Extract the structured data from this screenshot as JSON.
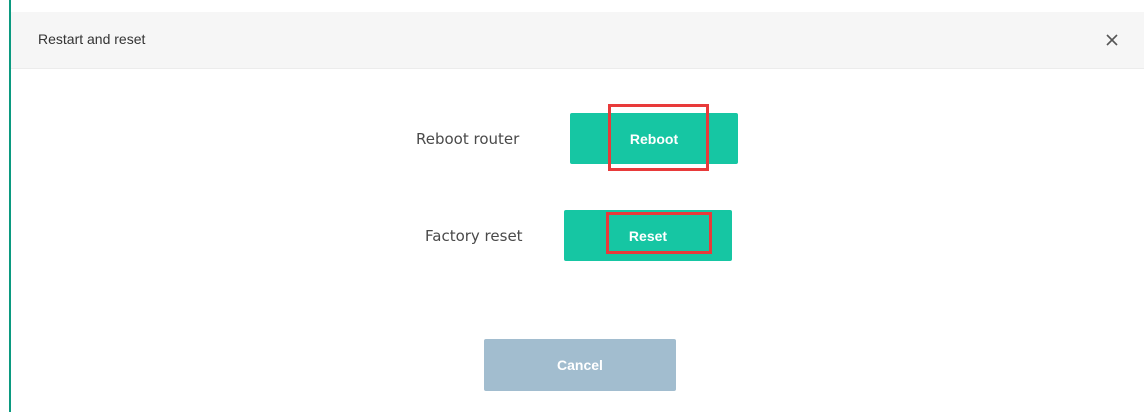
{
  "dialog": {
    "title": "Restart and reset",
    "close_icon": "close-icon"
  },
  "rows": {
    "reboot": {
      "label": "Reboot router",
      "button_label": "Reboot"
    },
    "reset": {
      "label": "Factory reset",
      "button_label": "Reset"
    }
  },
  "footer": {
    "cancel_label": "Cancel"
  },
  "colors": {
    "accent": "#16c6a3",
    "cancel": "#a2bdcf",
    "highlight": "#e83a3a",
    "edge": "#0b9a80"
  }
}
